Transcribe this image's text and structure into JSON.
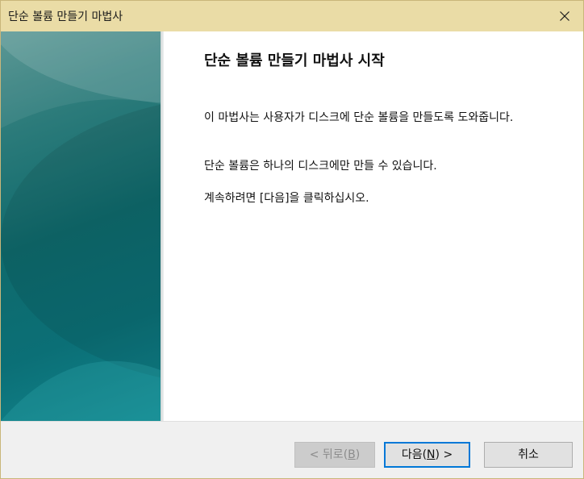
{
  "window": {
    "title": "단순 볼륨 만들기 마법사",
    "close_icon": "close-icon"
  },
  "content": {
    "heading": "단순 볼륨 만들기 마법사 시작",
    "paragraph1": "이 마법사는 사용자가 디스크에 단순 볼륨을 만들도록 도와줍니다.",
    "paragraph2": "단순 볼륨은 하나의 디스크에만 만들 수 있습니다.",
    "paragraph3": "계속하려면 [다음]을 클릭하십시오."
  },
  "buttons": {
    "back": {
      "prefix": "< 뒤로(",
      "accel": "B",
      "suffix": ")",
      "enabled": false
    },
    "next": {
      "prefix": "다음(",
      "accel": "N",
      "suffix": ") >",
      "enabled": true
    },
    "cancel": {
      "label": "취소",
      "enabled": true
    }
  },
  "colors": {
    "titlebar": "#eadca6",
    "panel": "#0f6a6c",
    "focus_border": "#0078d7"
  }
}
